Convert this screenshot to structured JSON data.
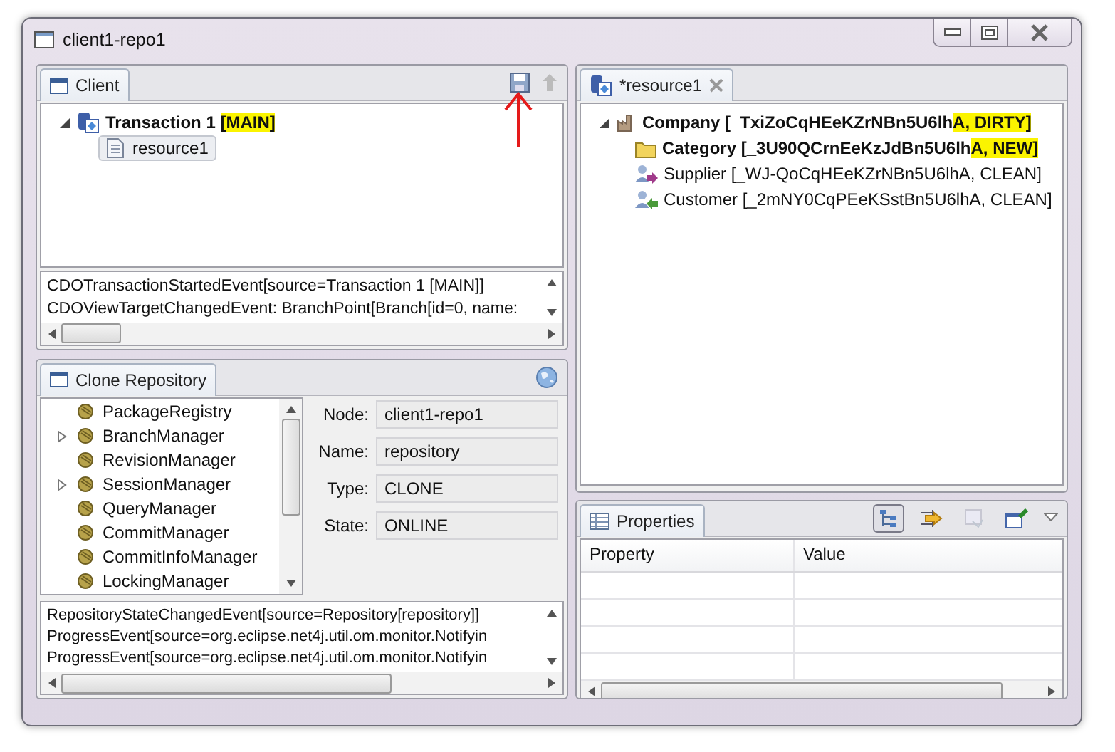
{
  "window": {
    "title": "client1-repo1"
  },
  "client_view": {
    "tab": "Client",
    "tree": [
      {
        "kind": "transaction",
        "text": "Transaction 1 ",
        "highlight": "[MAIN]",
        "bold": true,
        "expanded": true,
        "children": [
          {
            "kind": "resource",
            "text": "resource1",
            "bold": false,
            "selected": true
          }
        ]
      }
    ],
    "log": [
      "CDOTransactionStartedEvent[source=Transaction 1 [MAIN]]",
      "CDOViewTargetChangedEvent: BranchPoint[Branch[id=0, name:"
    ]
  },
  "clone_view": {
    "tab": "Clone Repository",
    "tree": [
      {
        "text": "PackageRegistry",
        "expandable": false
      },
      {
        "text": "BranchManager",
        "expandable": true
      },
      {
        "text": "RevisionManager",
        "expandable": false
      },
      {
        "text": "SessionManager",
        "expandable": true
      },
      {
        "text": "QueryManager",
        "expandable": false
      },
      {
        "text": "CommitManager",
        "expandable": false
      },
      {
        "text": "CommitInfoManager",
        "expandable": false
      },
      {
        "text": "LockingManager",
        "expandable": false
      }
    ],
    "fields": [
      {
        "label": "Node:",
        "value": "client1-repo1"
      },
      {
        "label": "Name:",
        "value": "repository"
      },
      {
        "label": "Type:",
        "value": "CLONE"
      },
      {
        "label": "State:",
        "value": "ONLINE"
      }
    ],
    "log": [
      "RepositoryStateChangedEvent[source=Repository[repository]]",
      "ProgressEvent[source=org.eclipse.net4j.util.om.monitor.Notifyin",
      "ProgressEvent[source=org.eclipse.net4j.util.om.monitor.Notifyin"
    ]
  },
  "editor": {
    "tab": "*resource1",
    "tree": [
      {
        "kind": "company",
        "text": "Company [_TxiZoCqHEeKZrNBn5U6lh",
        "highlight": "A, DIRTY]",
        "bold": true,
        "expanded": true,
        "children": [
          {
            "kind": "category",
            "text": "Category [_3U90QCrnEeKzJdBn5U6lh",
            "highlight": "A, NEW]",
            "bold": true
          },
          {
            "kind": "supplier",
            "text": "Supplier [_WJ-QoCqHEeKZrNBn5U6lhA, CLEAN]",
            "bold": false
          },
          {
            "kind": "customer",
            "text": "Customer [_2mNY0CqPEeKSstBn5U6lhA, CLEAN]",
            "bold": false
          }
        ]
      }
    ]
  },
  "properties": {
    "tab": "Properties",
    "toolbar": [
      {
        "kind": "tree",
        "selected": true,
        "disabled": false
      },
      {
        "kind": "filter",
        "selected": false,
        "disabled": false
      },
      {
        "kind": "restore",
        "selected": false,
        "disabled": true
      },
      {
        "kind": "pin",
        "selected": false,
        "disabled": false
      }
    ],
    "columns": [
      "Property",
      "Value"
    ]
  }
}
